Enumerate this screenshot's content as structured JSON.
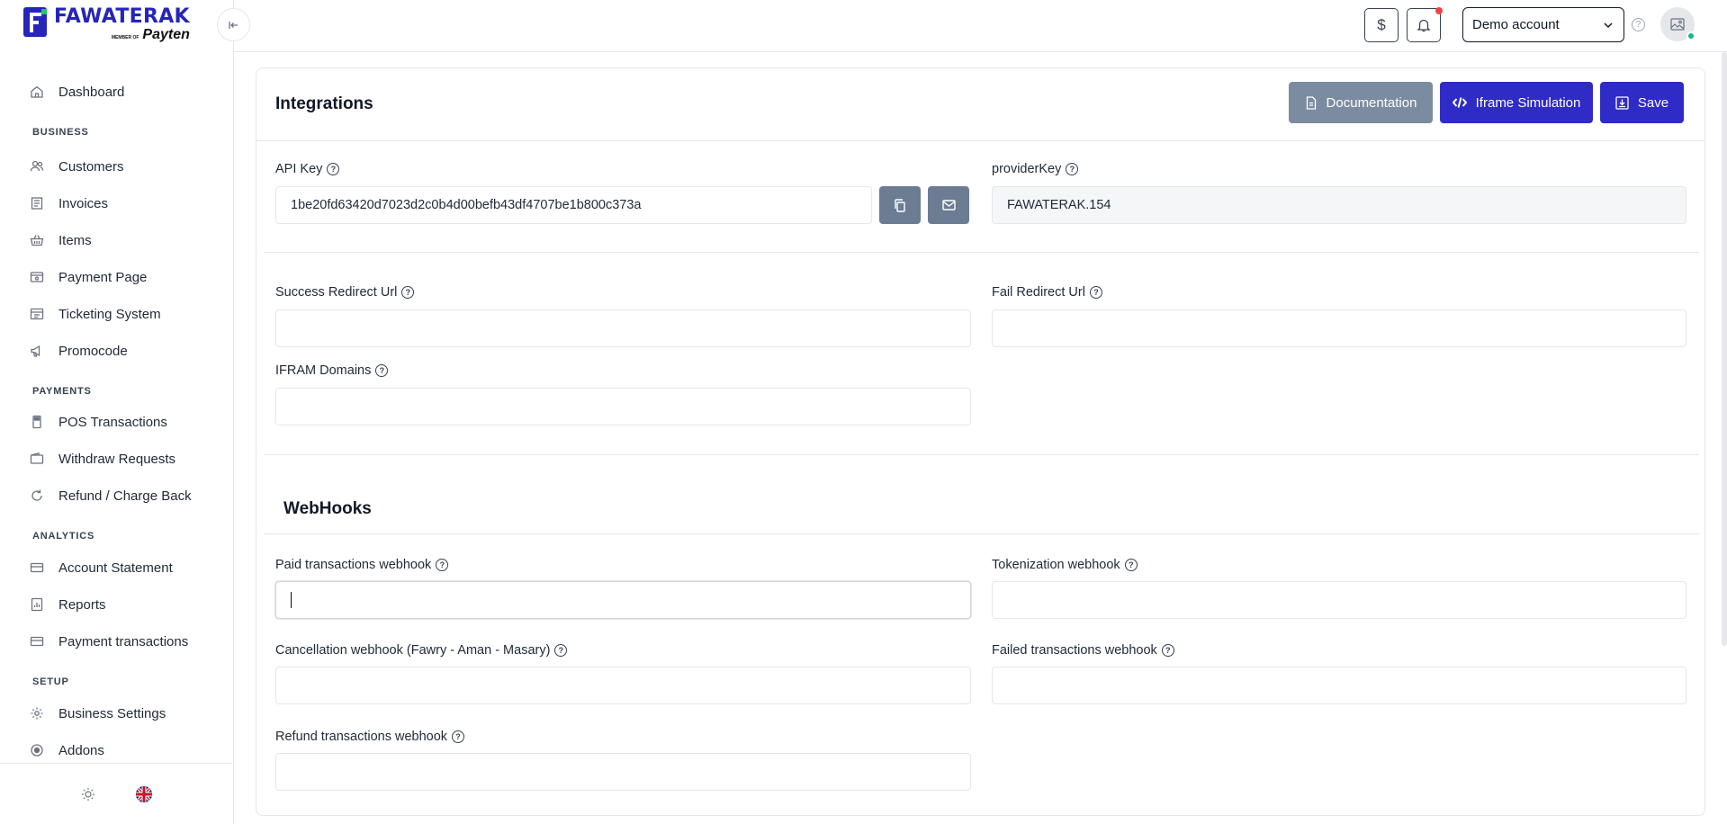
{
  "brand": {
    "name": "FAWATERAK",
    "member_of": "MEMBER OF",
    "partner": "Payten"
  },
  "nav": {
    "dashboard": "Dashboard",
    "section_business": "BUSINESS",
    "customers": "Customers",
    "invoices": "Invoices",
    "items": "Items",
    "payment_page": "Payment Page",
    "ticketing_system": "Ticketing System",
    "promocode": "Promocode",
    "section_payments": "PAYMENTS",
    "pos_transactions": "POS Transactions",
    "withdraw_requests": "Withdraw Requests",
    "refund_charge_back": "Refund / Charge Back",
    "section_analytics": "ANALYTICS",
    "account_statement": "Account Statement",
    "reports": "Reports",
    "payment_transactions": "Payment transactions",
    "section_setup": "SETUP",
    "business_settings": "Business Settings",
    "addons": "Addons"
  },
  "header": {
    "currency_symbol": "$",
    "account_selected": "Demo account"
  },
  "page": {
    "title": "Integrations",
    "buttons": {
      "documentation": "Documentation",
      "iframe_simulation": "Iframe Simulation",
      "save": "Save"
    },
    "fields": {
      "api_key_label": "API Key",
      "api_key_value": "1be20fd63420d7023d2c0b4d00befb43df4707be1b800c373a",
      "provider_key_label": "providerKey",
      "provider_key_value": "FAWATERAK.154",
      "success_redirect_label": "Success Redirect Url",
      "success_redirect_value": "",
      "fail_redirect_label": "Fail Redirect Url",
      "fail_redirect_value": "",
      "iframe_domains_label": "IFRAM Domains",
      "iframe_domains_value": ""
    },
    "webhooks": {
      "title": "WebHooks",
      "paid_label": "Paid transactions webhook",
      "paid_value": "",
      "tokenization_label": "Tokenization webhook",
      "tokenization_value": "",
      "cancellation_label": "Cancellation webhook (Fawry - Aman - Masary)",
      "cancellation_value": "",
      "failed_label": "Failed transactions webhook",
      "failed_value": "",
      "refund_label": "Refund transactions webhook",
      "refund_value": ""
    }
  },
  "colors": {
    "primary": "#2f2bc7",
    "secondary": "#7c8ca0",
    "notification_dot": "#ef4444",
    "online_dot": "#10b981"
  }
}
